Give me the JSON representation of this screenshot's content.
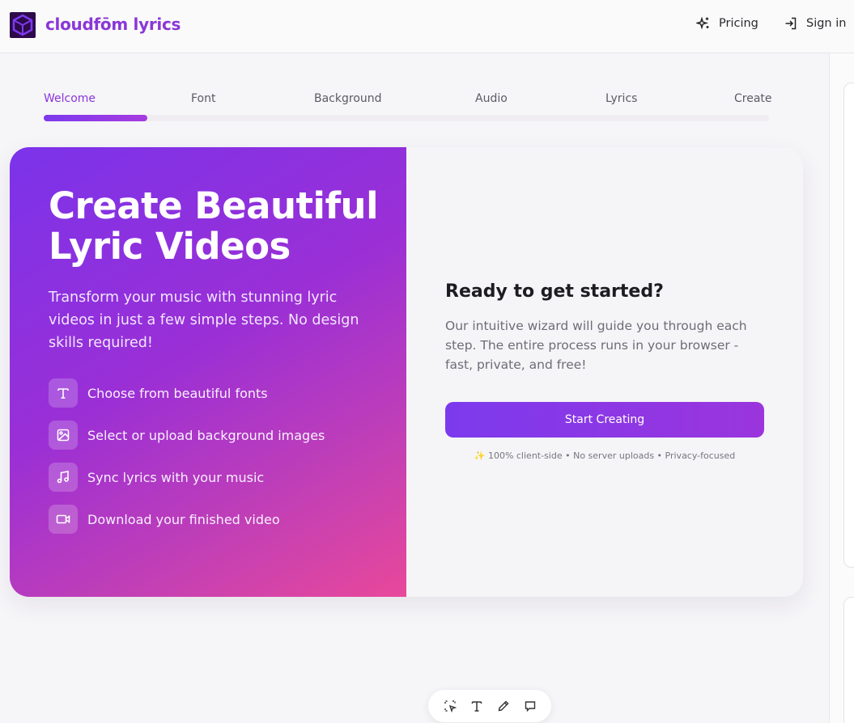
{
  "header": {
    "brand": "cloudfōm lyrics",
    "pricing_label": "Pricing",
    "signin_label": "Sign in"
  },
  "steps": {
    "items": [
      "Welcome",
      "Font",
      "Background",
      "Audio",
      "Lyrics",
      "Create"
    ],
    "active_index": 0
  },
  "hero": {
    "title": "Create Beautiful Lyric Videos",
    "subtitle": "Transform your music with stunning lyric videos in just a few simple steps. No design skills required!",
    "features": [
      {
        "icon": "text-icon",
        "label": "Choose from beautiful fonts"
      },
      {
        "icon": "image-icon",
        "label": "Select or upload background images"
      },
      {
        "icon": "music-icon",
        "label": "Sync lyrics with your music"
      },
      {
        "icon": "video-icon",
        "label": "Download your finished video"
      }
    ]
  },
  "cta": {
    "title": "Ready to get started?",
    "description": "Our intuitive wizard will guide you through each step. The entire process runs in your browser - fast, private, and free!",
    "button_label": "Start Creating",
    "note": "✨ 100% client-side • No server uploads • Privacy-focused"
  },
  "toolbar": {
    "tools": [
      "select-icon",
      "text-icon",
      "pen-icon",
      "comment-icon"
    ]
  },
  "colors": {
    "accent": "#8a37d8",
    "gradient_start": "#7b33ea",
    "gradient_end": "#e8489a"
  }
}
